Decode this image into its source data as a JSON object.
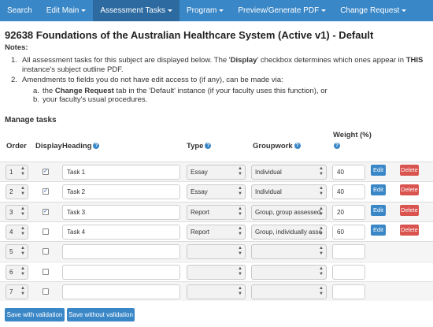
{
  "nav": {
    "items": [
      {
        "label": "Search",
        "dropdown": false,
        "active": false
      },
      {
        "label": "Edit Main",
        "dropdown": true,
        "active": false
      },
      {
        "label": "Assessment Tasks",
        "dropdown": true,
        "active": true
      },
      {
        "label": "Program",
        "dropdown": true,
        "active": false
      },
      {
        "label": "Preview/Generate PDF",
        "dropdown": true,
        "active": false
      },
      {
        "label": "Change Request",
        "dropdown": true,
        "active": false
      }
    ]
  },
  "page_title": "92638 Foundations of the Australian Healthcare System (Active v1) - Default",
  "notes": {
    "label": "Notes:",
    "item1": {
      "num": "1.",
      "t1": "All assessment tasks for this subject are displayed below. The '",
      "b1": "Display",
      "t2": "' checkbox determines which ones appear in ",
      "b2": "THIS",
      "t3": " instance's subject outline PDF."
    },
    "item2": {
      "num": "2.",
      "text": "Amendments to fields you do not have edit access to (if any), can be made via:"
    },
    "sub_a": {
      "num": "a.",
      "t1": "the ",
      "b1": "Change Request",
      "t2": " tab in the 'Default' instance (if your faculty uses this function), or"
    },
    "sub_b": {
      "num": "b.",
      "text": "your faculty's usual procedures."
    }
  },
  "manage_heading": "Manage tasks",
  "table": {
    "headers": {
      "order": "Order",
      "display": "Display",
      "heading": "Heading",
      "type": "Type",
      "groupwork": "Groupwork",
      "weight": "Weight (%)"
    },
    "help_icon": "?",
    "edit_label": "Edit",
    "delete_label": "Delete",
    "rows": [
      {
        "order": "1",
        "display": true,
        "heading": "Task 1",
        "type": "Essay",
        "groupwork": "Individual",
        "weight": "40",
        "actions": true
      },
      {
        "order": "2",
        "display": true,
        "heading": "Task 2",
        "type": "Essay",
        "groupwork": "Individual",
        "weight": "40",
        "actions": true
      },
      {
        "order": "3",
        "display": true,
        "heading": "Task 3",
        "type": "Report",
        "groupwork": "Group, group assessed",
        "weight": "20",
        "actions": true
      },
      {
        "order": "4",
        "display": false,
        "heading": "Task 4",
        "type": "Report",
        "groupwork": "Group, individually asse",
        "weight": "60",
        "actions": true
      },
      {
        "order": "5",
        "display": false,
        "heading": "",
        "type": "",
        "groupwork": "",
        "weight": "",
        "actions": false
      },
      {
        "order": "6",
        "display": false,
        "heading": "",
        "type": "",
        "groupwork": "",
        "weight": "",
        "actions": false
      },
      {
        "order": "7",
        "display": false,
        "heading": "",
        "type": "",
        "groupwork": "",
        "weight": "",
        "actions": false
      }
    ]
  },
  "buttons": {
    "save_with": "Save with validation",
    "save_without": "Save without validation"
  },
  "colors": {
    "nav_bg": "#3a87c7",
    "nav_active": "#2c6aa0",
    "primary": "#3a87c7",
    "danger": "#d9534f"
  },
  "icons": {
    "help": "question-circle-icon",
    "checkbox": "checkbox-icon",
    "select_arrows": "up-down-arrows-icon",
    "dropdown": "caret-down-icon"
  }
}
